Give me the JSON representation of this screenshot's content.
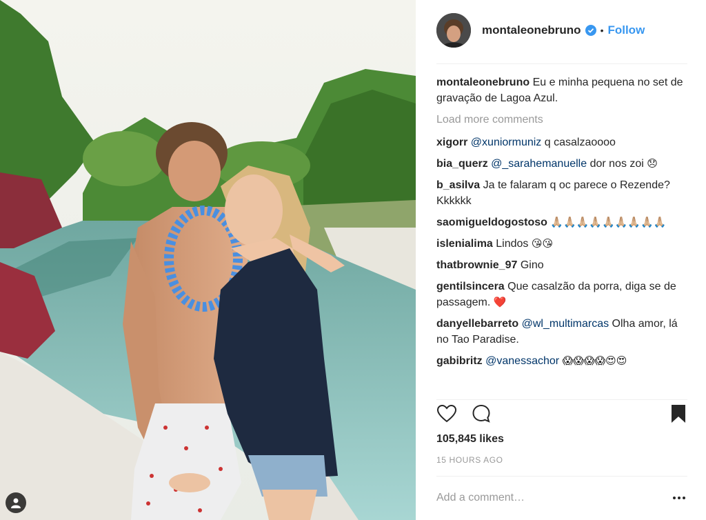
{
  "post": {
    "username": "montaleonebruno",
    "follow_label": "Follow",
    "dot": "•",
    "icons": {
      "verified": "verified-badge-icon",
      "like": "heart-icon",
      "comment": "comment-bubble-icon",
      "save": "bookmark-icon",
      "more": "more-options-icon",
      "tagged": "person-tag-icon"
    },
    "colors": {
      "follow": "#3897f0",
      "mention": "#003569",
      "muted": "#999999"
    }
  },
  "caption": {
    "username": "montaleonebruno",
    "text": "Eu e minha pequena no set de gravação de Lagoa Azul."
  },
  "load_more": "Load more comments",
  "comments": [
    {
      "user": "xigorr",
      "mention": "@xuniormuniz",
      "text": " q casalzaoooo",
      "emoji": ""
    },
    {
      "user": "bia_querz",
      "mention": "@_sarahemanuelle",
      "text": " dor nos zoi ",
      "emoji": "😞"
    },
    {
      "user": "b_asilva",
      "mention": "",
      "text": "Ja te falaram q oc parece o Rezende? Kkkkkk",
      "emoji": ""
    },
    {
      "user": "saomigueldogostoso",
      "mention": "",
      "text": "",
      "emoji": "🙏🏼🙏🏼🙏🏼🙏🏼🙏🏼🙏🏼🙏🏼🙏🏼🙏🏼"
    },
    {
      "user": "islenialima",
      "mention": "",
      "text": "Lindos ",
      "emoji": "😘😘"
    },
    {
      "user": "thatbrownie_97",
      "mention": "",
      "text": "Gino",
      "emoji": ""
    },
    {
      "user": "gentilsincera",
      "mention": "",
      "text": "Que casalzão da porra, diga se de passagem. ",
      "emoji": "❤️"
    },
    {
      "user": "danyellebarreto",
      "mention": "@wl_multimarcas",
      "text": " Olha amor, lá no Tao Paradise.",
      "emoji": ""
    },
    {
      "user": "gabibritz",
      "mention": "@vanessachor",
      "text": " ",
      "emoji": "😱😱😱😱😍😍"
    }
  ],
  "likes": "105,845 likes",
  "time_ago": "15 HOURS AGO",
  "add_comment": {
    "placeholder": "Add a comment…"
  }
}
